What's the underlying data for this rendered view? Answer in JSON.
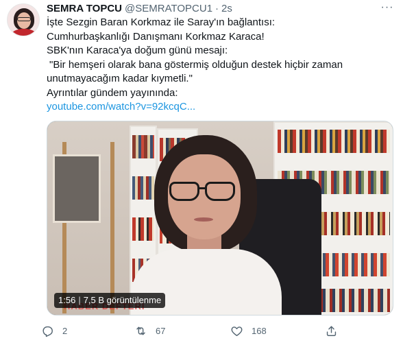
{
  "tweet": {
    "author_name": "SEMRA TOPCU",
    "author_handle": "@SEMRATOPCU1",
    "separator": "·",
    "timestamp": "2s",
    "more_label": "···",
    "lines": [
      "İşte Sezgin Baran Korkmaz ile Saray'ın bağlantısı:",
      "Cumhurbaşkanlığı Danışmanı Korkmaz Karaca!",
      "SBK'nın Karaca'ya doğum günü mesajı:",
      "\"Bir hemşeri olarak bana göstermiş olduğun destek hiçbir zaman",
      "unutmayacağım kadar kıymetli.\"",
      "Ayrıntılar gündem yayınında:"
    ],
    "link": "youtube.com/watch?v=92kcqC..."
  },
  "media": {
    "duration": "1:56",
    "separator": "|",
    "views": "7,5 B görüntülenme",
    "watermark": "HABER DEFTERI"
  },
  "actions": {
    "reply_count": "2",
    "retweet_count": "67",
    "like_count": "168"
  },
  "icons": {
    "reply": "reply-icon",
    "retweet": "retweet-icon",
    "like": "heart-icon",
    "share": "share-icon"
  },
  "colors": {
    "link": "#1b95e0",
    "secondary_text": "#536471",
    "primary_text": "#0f1419"
  }
}
